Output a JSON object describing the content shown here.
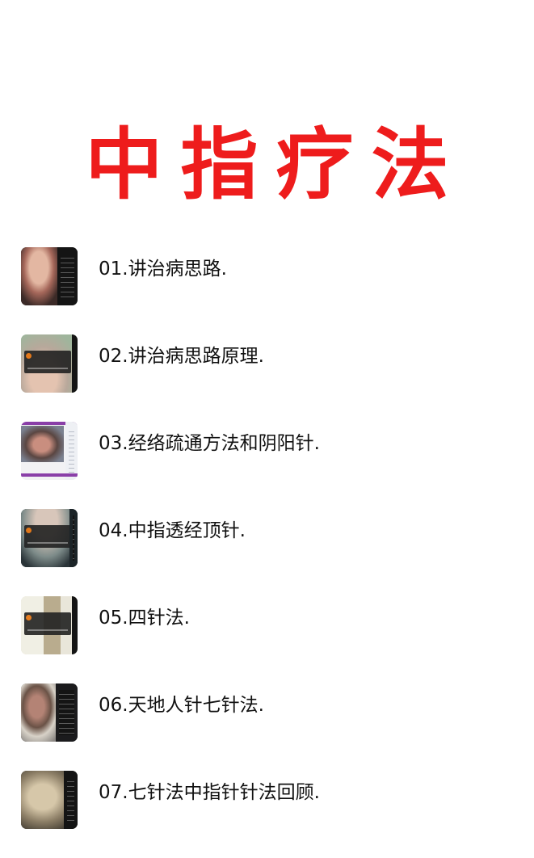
{
  "page": {
    "title": "中指疗法",
    "title_color": "#ee1c1c",
    "background_color": "#ffffff"
  },
  "lessons": [
    {
      "label": "01.讲治病思路."
    },
    {
      "label": "02.讲治病思路原理."
    },
    {
      "label": "03.经络疏通方法和阴阳针."
    },
    {
      "label": "04.中指透经顶针."
    },
    {
      "label": "05.四针法."
    },
    {
      "label": "06.天地人针七针法."
    },
    {
      "label": "07.七针法中指针针法回顾."
    }
  ]
}
